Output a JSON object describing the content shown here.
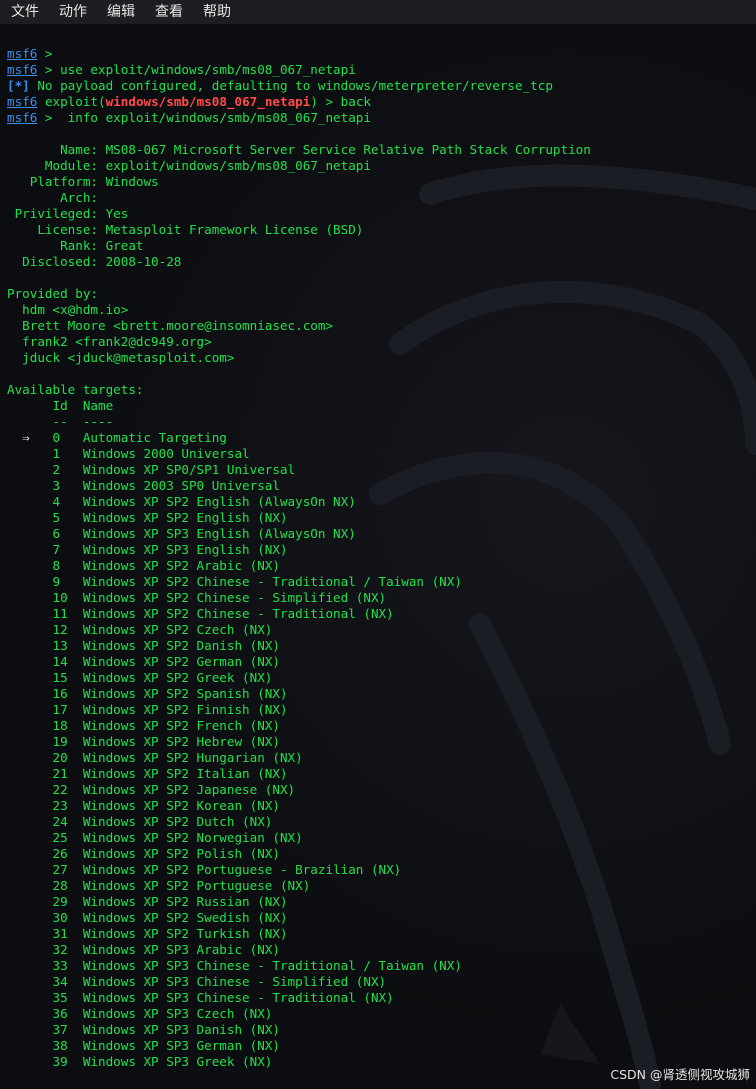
{
  "menu": [
    "文件",
    "动作",
    "编辑",
    "查看",
    "帮助"
  ],
  "session": {
    "prompt": "msf6",
    "cmd_use": "use exploit/windows/smb/ms08_067_netapi",
    "notice_bracket": "[*]",
    "notice_text": "No payload configured, defaulting to windows/meterpreter/reverse_tcp",
    "exploit_word": "exploit(",
    "exploit_path": "windows/smb/ms08_067_netapi",
    "exploit_close": ")",
    "cmd_back": "back",
    "cmd_info": "info exploit/windows/smb/ms08_067_netapi"
  },
  "module_info": {
    "name": "       Name: MS08-067 Microsoft Server Service Relative Path Stack Corruption",
    "module": "     Module: exploit/windows/smb/ms08_067_netapi",
    "platform": "   Platform: Windows",
    "arch": "       Arch:",
    "privileged": " Privileged: Yes",
    "license": "    License: Metasploit Framework License (BSD)",
    "rank": "       Rank: Great",
    "disclosed": "  Disclosed: 2008-10-28"
  },
  "provided_by": {
    "heading": "Provided by:",
    "authors": [
      "  hdm <x@hdm.io>",
      "  Brett Moore <brett.moore@insomniasec.com>",
      "  frank2 <frank2@dc949.org>",
      "  jduck <jduck@metasploit.com>"
    ]
  },
  "targets": {
    "heading": "Available targets:",
    "header": "      Id  Name",
    "divider": "      --  ----",
    "selected_arrow": "  ⇒",
    "rows": [
      "   0   Automatic Targeting",
      "      1   Windows 2000 Universal",
      "      2   Windows XP SP0/SP1 Universal",
      "      3   Windows 2003 SP0 Universal",
      "      4   Windows XP SP2 English (AlwaysOn NX)",
      "      5   Windows XP SP2 English (NX)",
      "      6   Windows XP SP3 English (AlwaysOn NX)",
      "      7   Windows XP SP3 English (NX)",
      "      8   Windows XP SP2 Arabic (NX)",
      "      9   Windows XP SP2 Chinese - Traditional / Taiwan (NX)",
      "      10  Windows XP SP2 Chinese - Simplified (NX)",
      "      11  Windows XP SP2 Chinese - Traditional (NX)",
      "      12  Windows XP SP2 Czech (NX)",
      "      13  Windows XP SP2 Danish (NX)",
      "      14  Windows XP SP2 German (NX)",
      "      15  Windows XP SP2 Greek (NX)",
      "      16  Windows XP SP2 Spanish (NX)",
      "      17  Windows XP SP2 Finnish (NX)",
      "      18  Windows XP SP2 French (NX)",
      "      19  Windows XP SP2 Hebrew (NX)",
      "      20  Windows XP SP2 Hungarian (NX)",
      "      21  Windows XP SP2 Italian (NX)",
      "      22  Windows XP SP2 Japanese (NX)",
      "      23  Windows XP SP2 Korean (NX)",
      "      24  Windows XP SP2 Dutch (NX)",
      "      25  Windows XP SP2 Norwegian (NX)",
      "      26  Windows XP SP2 Polish (NX)",
      "      27  Windows XP SP2 Portuguese - Brazilian (NX)",
      "      28  Windows XP SP2 Portuguese (NX)",
      "      29  Windows XP SP2 Russian (NX)",
      "      30  Windows XP SP2 Swedish (NX)",
      "      31  Windows XP SP2 Turkish (NX)",
      "      32  Windows XP SP3 Arabic (NX)",
      "      33  Windows XP SP3 Chinese - Traditional / Taiwan (NX)",
      "      34  Windows XP SP3 Chinese - Simplified (NX)",
      "      35  Windows XP SP3 Chinese - Traditional (NX)",
      "      36  Windows XP SP3 Czech (NX)",
      "      37  Windows XP SP3 Danish (NX)",
      "      38  Windows XP SP3 German (NX)",
      "      39  Windows XP SP3 Greek (NX)"
    ]
  },
  "watermark": "CSDN @肾透侧视攻城狮",
  "colors": {
    "terminal_text": "#23e04a",
    "prompt": "#3b8eea",
    "exploit_path": "#ff4b4b",
    "background": "#0c0d10",
    "menubar": "#1d1e22"
  }
}
